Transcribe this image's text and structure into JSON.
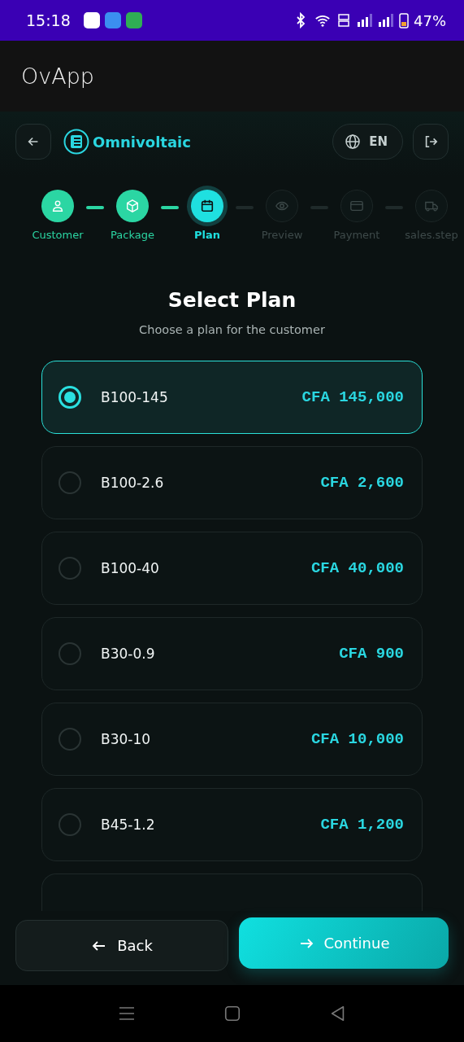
{
  "status_bar": {
    "time": "15:18",
    "battery": "47%"
  },
  "app_bar": {
    "title": "OvApp"
  },
  "header": {
    "brand": "Omnivoltaic",
    "language": "EN"
  },
  "steps": [
    {
      "label": "Customer",
      "completed": true,
      "selected": false
    },
    {
      "label": "Package",
      "completed": true,
      "selected": false
    },
    {
      "label": "Plan",
      "completed": false,
      "selected": true
    },
    {
      "label": "Preview",
      "completed": false,
      "selected": false
    },
    {
      "label": "Payment",
      "completed": false,
      "selected": false
    },
    {
      "label": "sales.step",
      "completed": false,
      "selected": false
    }
  ],
  "heading": {
    "title": "Select Plan",
    "subtitle": "Choose a plan for the customer"
  },
  "plans": [
    {
      "name": "B100-145",
      "price": "CFA 145,000",
      "selected": true
    },
    {
      "name": "B100-2.6",
      "price": "CFA 2,600",
      "selected": false
    },
    {
      "name": "B100-40",
      "price": "CFA 40,000",
      "selected": false
    },
    {
      "name": "B30-0.9",
      "price": "CFA 900",
      "selected": false
    },
    {
      "name": "B30-10",
      "price": "CFA 10,000",
      "selected": false
    },
    {
      "name": "B45-1.2",
      "price": "CFA 1,200",
      "selected": false
    }
  ],
  "footer": {
    "back": "Back",
    "continue": "Continue"
  }
}
